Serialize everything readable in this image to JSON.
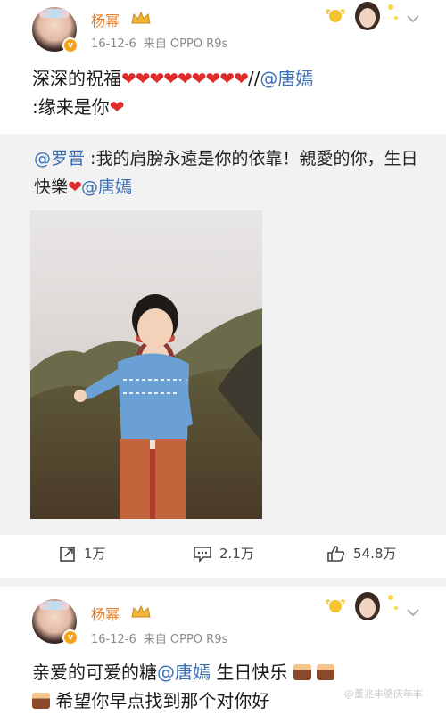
{
  "posts": [
    {
      "username": "杨幂",
      "timestamp": "16-12-6",
      "source": "来自 OPPO R9s",
      "content": {
        "prefix": "深深的祝福",
        "hearts": "❤❤❤❤❤❤❤❤❤",
        "slashes": "//",
        "mention": "@唐嫣",
        "line2_text": ":缘来是你",
        "line2_heart": "❤"
      },
      "repost": {
        "author_mention": "@罗晋",
        "text": " :我的肩膀永遠是你的依靠！親愛的你，生日快樂",
        "heart": "❤",
        "mention": "@唐嫣"
      },
      "actions": {
        "repost_count": "1万",
        "comment_count": "2.1万",
        "like_count": "54.8万"
      }
    },
    {
      "username": "杨幂",
      "timestamp": "16-12-6",
      "source": "来自 OPPO R9s",
      "content": {
        "prefix": "亲爱的可爱的糖",
        "mention": "@唐嫣",
        "suffix": " 生日快乐",
        "line2_text": "希望你早点找到那个对你好"
      }
    }
  ],
  "watermark": "@董兆丰骆庆年丰",
  "colors": {
    "username": "#ea7d24",
    "mention": "#3c6fb3",
    "heart": "#e02b2b",
    "meta": "#8a8a8a",
    "repost_bg": "#f2f2f2"
  }
}
